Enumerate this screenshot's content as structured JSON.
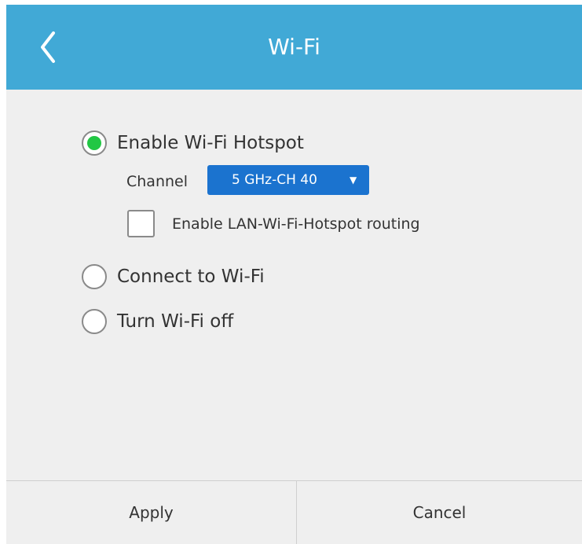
{
  "header": {
    "title": "Wi-Fi",
    "back_icon": "chevron-left-icon",
    "background_color": "#41a9d6"
  },
  "options": {
    "hotspot": {
      "label": "Enable Wi-Fi Hotspot",
      "selected": true
    },
    "connect": {
      "label": "Connect to Wi-Fi",
      "selected": false
    },
    "off": {
      "label": "Turn Wi-Fi off",
      "selected": false
    }
  },
  "hotspot_settings": {
    "channel_label": "Channel",
    "channel_value": "5 GHz-CH 40",
    "channel_caret": "▼",
    "routing_label": "Enable LAN-Wi-Fi-Hotspot routing",
    "routing_checked": false
  },
  "footer": {
    "apply_label": "Apply",
    "cancel_label": "Cancel"
  },
  "colors": {
    "accent": "#41a9d6",
    "select_bg": "#1b73cf",
    "radio_selected": "#22c744"
  }
}
